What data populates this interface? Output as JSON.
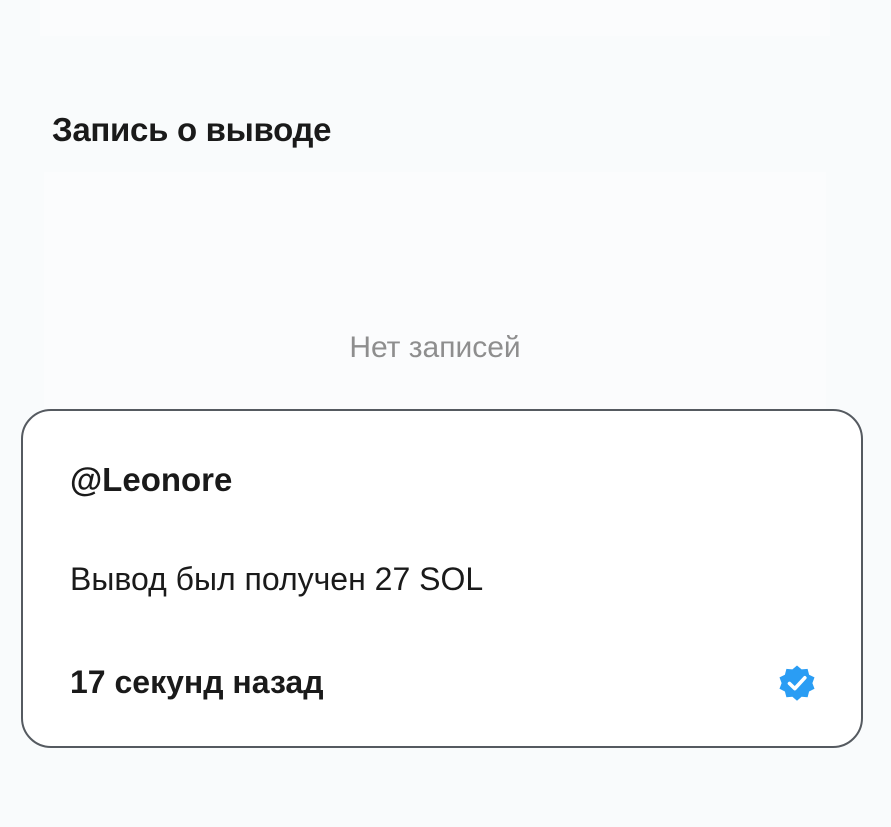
{
  "section": {
    "title": "Запись о выводе",
    "empty_text": "Нет записей"
  },
  "notification": {
    "username": "@Leonore",
    "message": "Вывод был получен 27 SOL",
    "time_ago": "17 секунд назад",
    "status_icon": "verified-badge-icon",
    "status_color": "#2a9df4"
  }
}
